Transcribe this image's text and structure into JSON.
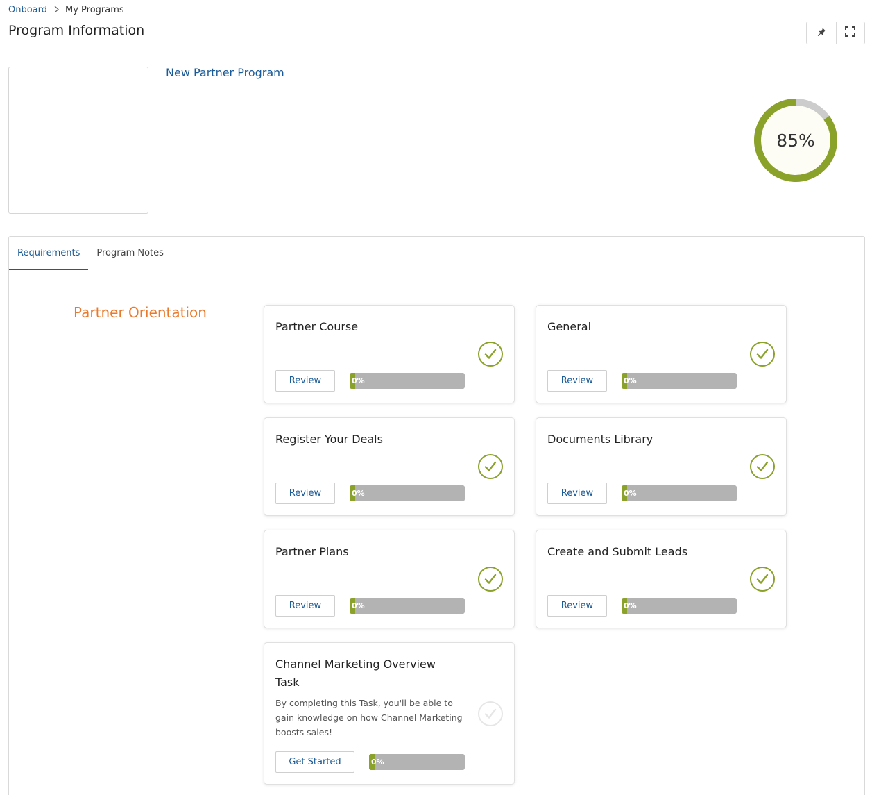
{
  "breadcrumb": {
    "root": "Onboard",
    "current": "My Programs"
  },
  "page": {
    "title": "Program Information"
  },
  "program": {
    "name": "New Partner Program",
    "completion": 85,
    "completion_label": "85%"
  },
  "tabs": [
    {
      "label": "Requirements",
      "active": true
    },
    {
      "label": "Program Notes",
      "active": false
    }
  ],
  "section": {
    "title": "Partner Orientation"
  },
  "tasks": [
    {
      "title": "Partner Course",
      "description": "",
      "button": "Review",
      "progress": 0,
      "progress_label": "0%",
      "completed": true
    },
    {
      "title": "General",
      "description": "",
      "button": "Review",
      "progress": 0,
      "progress_label": "0%",
      "completed": true
    },
    {
      "title": "Register Your Deals",
      "description": "",
      "button": "Review",
      "progress": 0,
      "progress_label": "0%",
      "completed": true
    },
    {
      "title": "Documents Library",
      "description": "",
      "button": "Review",
      "progress": 0,
      "progress_label": "0%",
      "completed": true
    },
    {
      "title": "Partner Plans",
      "description": "",
      "button": "Review",
      "progress": 0,
      "progress_label": "0%",
      "completed": true
    },
    {
      "title": "Create and Submit Leads",
      "description": "",
      "button": "Review",
      "progress": 0,
      "progress_label": "0%",
      "completed": true
    },
    {
      "title": "Channel Marketing Overview Task",
      "description": "By completing this Task, you'll be able to gain knowledge on how Channel Marketing boosts sales!",
      "button": "Get Started",
      "progress": 0,
      "progress_label": "0%",
      "completed": false
    }
  ],
  "icons": {
    "pin": "pin-icon",
    "fullscreen": "fullscreen-icon",
    "breadcrumb_separator": "chevron-right-icon",
    "task_status": "check-circle-icon"
  },
  "colors": {
    "link": "#1a5a96",
    "accent_green": "#8aa22a",
    "section_orange": "#e87a2e",
    "ring_track": "#cccccc",
    "progress_track": "#b3b3b3"
  }
}
